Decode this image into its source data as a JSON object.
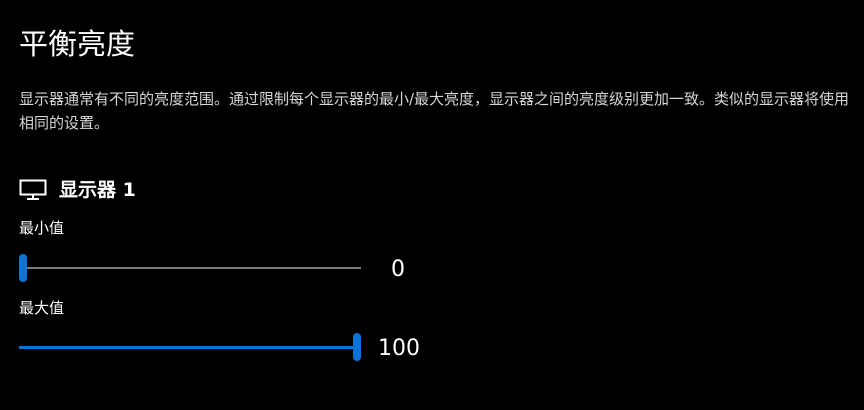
{
  "page": {
    "title": "平衡亮度",
    "description": "显示器通常有不同的亮度范围。通过限制每个显示器的最小/最大亮度，显示器之间的亮度级别更加一致。类似的显示器将使用相同的设置。"
  },
  "monitor": {
    "icon": "monitor-icon",
    "name": "显示器 1"
  },
  "sliders": {
    "min": {
      "label": "最小值",
      "value": "0",
      "fraction": 0.0
    },
    "max": {
      "label": "最大值",
      "value": "100",
      "fraction": 1.0
    }
  },
  "colors": {
    "background": "#000000",
    "accent": "#0b74d6",
    "track": "#7a7a7a",
    "text": "#ffffff"
  }
}
